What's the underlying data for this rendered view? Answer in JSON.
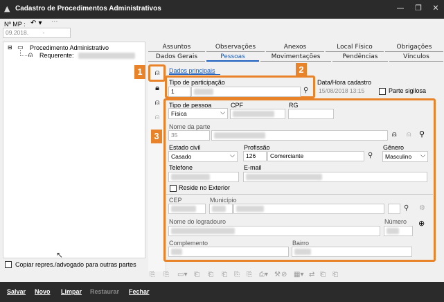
{
  "window": {
    "title": "Cadastro de Procedimentos Administrativos",
    "logo_icon": "app-logo-icon",
    "controls": [
      "minimize-icon",
      "restore-icon",
      "close-icon"
    ]
  },
  "top": {
    "mp_label": "Nº MP :",
    "mp_value": "09.2018.",
    "mp_suffix": "-",
    "undo_icon": "undo-icon",
    "more_icon": "ellipsis-icon"
  },
  "tree": {
    "root_toggle": "⊟",
    "root_label": "Procedimento Administrativo",
    "child_label": "Requerente:",
    "copy_label": "Copiar repres./advogado para outras partes"
  },
  "tabs_row1": [
    "Assuntos",
    "Observações",
    "Anexos",
    "Local Físico",
    "Obrigações"
  ],
  "tabs_row2": [
    "Dados Gerais",
    "Pessoas",
    "Movimentações",
    "Pendências",
    "Vínculos"
  ],
  "active_tab": "Pessoas",
  "subtab": "Dados principais",
  "badges": [
    "1",
    "2",
    "3"
  ],
  "form": {
    "tipo_participacao_label": "Tipo de participação",
    "tipo_participacao_code": "1",
    "data_hora_label": "Data/Hora cadastro",
    "data_hora_value": "15/08/2018 13:15",
    "parte_sigilosa_label": "Parte sigilosa",
    "tipo_pessoa_label": "Tipo de pessoa",
    "tipo_pessoa_value": "Física",
    "cpf_label": "CPF",
    "rg_label": "RG",
    "nome_parte_label": "Nome da parte",
    "nome_parte_code": "35",
    "estado_civil_label": "Estado civil",
    "estado_civil_value": "Casado",
    "profissao_label": "Profissão",
    "profissao_code": "126",
    "profissao_value": "Comerciante",
    "genero_label": "Gênero",
    "genero_value": "Masculino",
    "telefone_label": "Telefone",
    "email_label": "E-mail",
    "reside_exterior_label": "Reside no Exterior",
    "cep_label": "CEP",
    "municipio_label": "Município",
    "logradouro_label": "Nome do logradouro",
    "numero_label": "Número",
    "complemento_label": "Complemento",
    "bairro_label": "Bairro"
  },
  "bottom": {
    "salvar": "Salvar",
    "novo": "Novo",
    "limpar": "Limpar",
    "restaurar": "Restaurar",
    "fechar": "Fechar"
  },
  "colors": {
    "accent": "#e8832a",
    "tab_active": "#1d5fbf",
    "titlebar": "#2b2b2b"
  }
}
